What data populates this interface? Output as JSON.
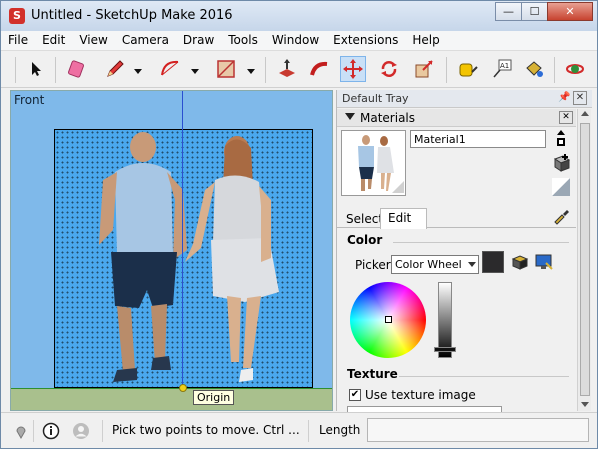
{
  "window": {
    "title": "Untitled - SketchUp Make 2016",
    "controls": {
      "minimize": "—",
      "maximize": "☐",
      "close": "✕"
    }
  },
  "menu": [
    "File",
    "Edit",
    "View",
    "Camera",
    "Draw",
    "Tools",
    "Window",
    "Extensions",
    "Help"
  ],
  "toolbar": {
    "tools": [
      "select-icon",
      "eraser-icon",
      "pencil-line-icon",
      "arc-icon",
      "rectangle-icon",
      "push-pull-icon",
      "follow-me-icon",
      "move-icon",
      "rotate-icon",
      "scale-icon",
      "tape-measure-icon",
      "text-icon",
      "paint-bucket-icon",
      "orbit-icon"
    ],
    "active_tool": "move-icon"
  },
  "viewport": {
    "scene_label": "Front",
    "tooltip": "Origin",
    "colors": {
      "sky": "#7fb9ea",
      "ground": "#a9c08d",
      "image_fill": "#4aa8ee"
    }
  },
  "tray": {
    "title": "Default Tray",
    "panel_title": "Materials",
    "material_name": "Material1",
    "tabs": [
      "Select",
      "Edit"
    ],
    "active_tab": "Edit",
    "color_section": "Color",
    "picker_label": "Picker:",
    "picker_value": "Color Wheel",
    "swatch_color": "#2b2a2c",
    "texture_section": "Texture",
    "use_texture_label": "Use texture image",
    "use_texture_checked": "✔"
  },
  "statusbar": {
    "hint": "Pick two points to move.  Ctrl ...",
    "measure_label": "Length",
    "measure_value": ""
  }
}
